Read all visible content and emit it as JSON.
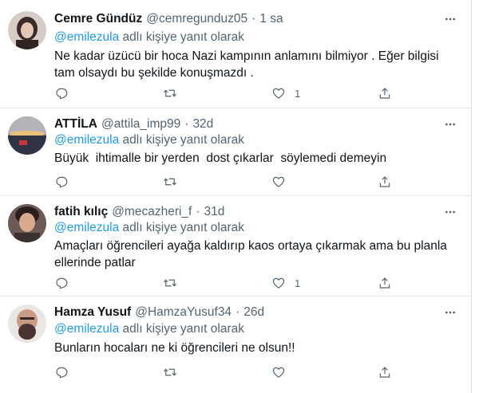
{
  "reply_prefix_mention": "@emilezula",
  "reply_prefix_suffix": " adlı kişiye yanıt olarak",
  "tweets": [
    {
      "name": "Cemre Gündüz",
      "handle": "@cemregunduz05",
      "time": "1 sa",
      "text": "Ne kadar üzücü bir hoca Nazi kampının anlamını bilmiyor . Eğer bilgisi tam olsaydı bu şekilde konuşmazdı .",
      "likes": "1"
    },
    {
      "name": "ATTİLA",
      "handle": "@attila_imp99",
      "time": "32d",
      "text": "Büyük  ihtimalle bir yerden  dost çıkarlar  söylemedi demeyin",
      "likes": ""
    },
    {
      "name": "fatih kılıç",
      "handle": "@mecazheri_f",
      "time": "31d",
      "text": "Amaçları öğrencileri ayağa kaldırıp kaos ortaya çıkarmak ama bu planla ellerinde patlar",
      "likes": "1"
    },
    {
      "name": "Hamza Yusuf",
      "handle": "@HamzaYusuf34",
      "time": "26d",
      "text": "Bunların hocaları ne ki öğrencileri ne olsun!!",
      "likes": ""
    }
  ],
  "separator": "·",
  "icons": {
    "more": "more-horizontal-icon",
    "reply": "reply-icon",
    "retweet": "retweet-icon",
    "like": "heart-icon",
    "share": "share-icon"
  }
}
